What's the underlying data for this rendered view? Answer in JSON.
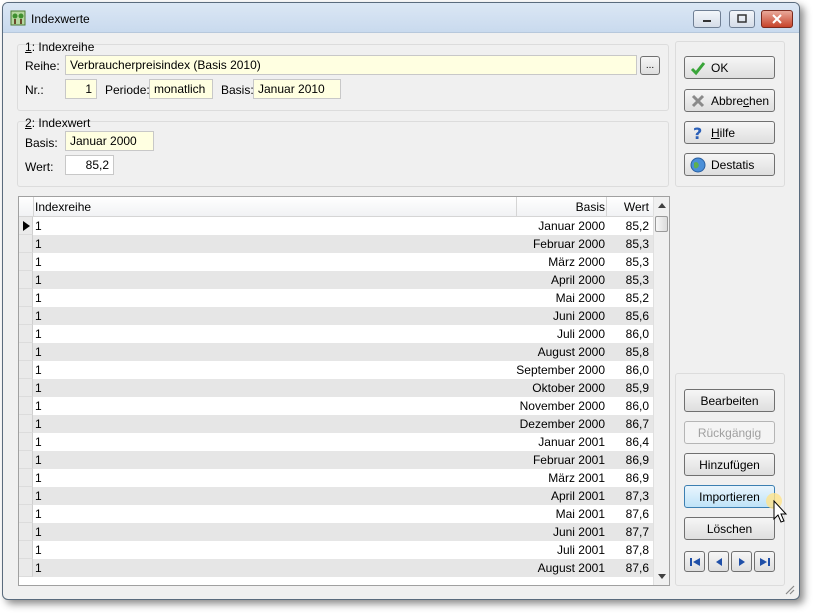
{
  "window": {
    "title": "Indexwerte"
  },
  "group1": {
    "title_key": "1",
    "title_rest": ": Indexreihe",
    "reihe_label": "Reihe:",
    "reihe_value": "Verbraucherpreisindex (Basis 2010)",
    "browse_label": "...",
    "nr_label": "Nr.:",
    "nr_value": "1",
    "periode_label": "Periode:",
    "periode_value": "monatlich",
    "basis_label": "Basis:",
    "basis_value": "Januar 2010"
  },
  "group2": {
    "title_key": "2",
    "title_rest": ": Indexwert",
    "basis_label": "Basis:",
    "basis_value": "Januar 2000",
    "wert_label": "Wert:",
    "wert_value": "85,2"
  },
  "buttons": {
    "ok": "OK",
    "abbrechen_pre": "Abbre",
    "abbrechen_key": "c",
    "abbrechen_post": "hen",
    "hilfe_key": "H",
    "hilfe_post": "ilfe",
    "destatis": "Destatis",
    "bearbeiten": "Bearbeiten",
    "rueckgaengig": "Rückgängig",
    "hinzufuegen": "Hinzufügen",
    "importieren": "Importieren",
    "loeschen": "Löschen"
  },
  "grid": {
    "columns": [
      "Indexreihe",
      "Basis",
      "Wert"
    ],
    "rows": [
      {
        "idx": "1",
        "basis": "Januar 2000",
        "wert": "85,2"
      },
      {
        "idx": "1",
        "basis": "Februar 2000",
        "wert": "85,3"
      },
      {
        "idx": "1",
        "basis": "März 2000",
        "wert": "85,3"
      },
      {
        "idx": "1",
        "basis": "April 2000",
        "wert": "85,3"
      },
      {
        "idx": "1",
        "basis": "Mai 2000",
        "wert": "85,2"
      },
      {
        "idx": "1",
        "basis": "Juni 2000",
        "wert": "85,6"
      },
      {
        "idx": "1",
        "basis": "Juli 2000",
        "wert": "86,0"
      },
      {
        "idx": "1",
        "basis": "August 2000",
        "wert": "85,8"
      },
      {
        "idx": "1",
        "basis": "September 2000",
        "wert": "86,0"
      },
      {
        "idx": "1",
        "basis": "Oktober 2000",
        "wert": "85,9"
      },
      {
        "idx": "1",
        "basis": "November 2000",
        "wert": "86,0"
      },
      {
        "idx": "1",
        "basis": "Dezember 2000",
        "wert": "86,7"
      },
      {
        "idx": "1",
        "basis": "Januar 2001",
        "wert": "86,4"
      },
      {
        "idx": "1",
        "basis": "Februar 2001",
        "wert": "86,9"
      },
      {
        "idx": "1",
        "basis": "März 2001",
        "wert": "86,9"
      },
      {
        "idx": "1",
        "basis": "April 2001",
        "wert": "87,3"
      },
      {
        "idx": "1",
        "basis": "Mai 2001",
        "wert": "87,6"
      },
      {
        "idx": "1",
        "basis": "Juni 2001",
        "wert": "87,7"
      },
      {
        "idx": "1",
        "basis": "Juli 2001",
        "wert": "87,8"
      },
      {
        "idx": "1",
        "basis": "August 2001",
        "wert": "87,6"
      }
    ]
  },
  "icons": {
    "ok": "checkmark-icon",
    "abbrechen": "cross-icon",
    "hilfe": "question-icon",
    "destatis": "globe-icon"
  },
  "colors": {
    "field_highlight": "#ffffe1",
    "row_alt": "#e6e6e6",
    "hot_button": "#bfe3f8"
  }
}
